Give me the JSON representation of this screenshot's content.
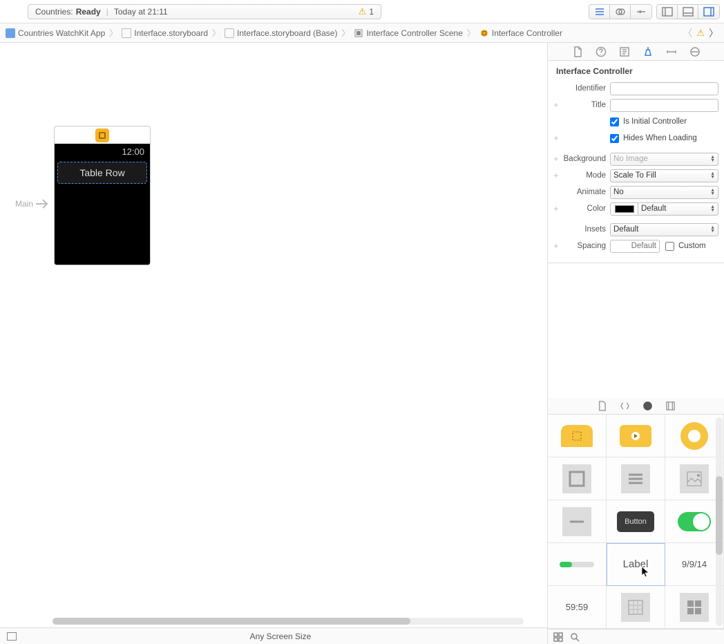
{
  "toolbar": {
    "status_project": "Countries:",
    "status_state": "Ready",
    "status_time": "Today at 21:11",
    "warning_count": "1"
  },
  "breadcrumb": {
    "items": [
      {
        "label": "Countries WatchKit App"
      },
      {
        "label": "Interface.storyboard"
      },
      {
        "label": "Interface.storyboard (Base)"
      },
      {
        "label": "Interface Controller Scene"
      },
      {
        "label": "Interface Controller"
      }
    ]
  },
  "canvas": {
    "entry_label": "Main",
    "watch_time": "12:00",
    "table_row_label": "Table Row",
    "bottom_size": "Any Screen Size"
  },
  "inspector": {
    "header": "Interface Controller",
    "identifier_label": "Identifier",
    "identifier_value": "",
    "title_label": "Title",
    "title_value": "",
    "is_initial_label": "Is Initial Controller",
    "hides_label": "Hides When Loading",
    "background_label": "Background",
    "background_value": "No Image",
    "mode_label": "Mode",
    "mode_value": "Scale To Fill",
    "animate_label": "Animate",
    "animate_value": "No",
    "color_label": "Color",
    "color_value": "Default",
    "insets_label": "Insets",
    "insets_value": "Default",
    "spacing_label": "Spacing",
    "spacing_placeholder": "Default",
    "custom_label": "Custom"
  },
  "library": {
    "button_label": "Button",
    "label_label": "Label",
    "date_label": "9/9/14",
    "timer_label": "59:59"
  }
}
